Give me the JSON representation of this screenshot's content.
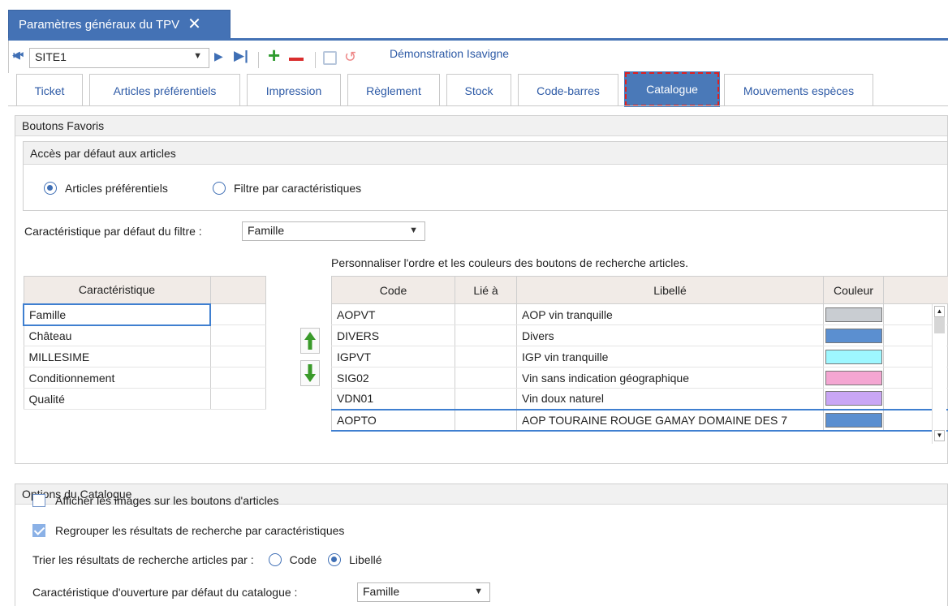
{
  "window": {
    "tab_title": "Paramètres généraux du TPV"
  },
  "toolbar": {
    "site_value": "SITE1",
    "company": "Démonstration Isavigne"
  },
  "tabs": [
    {
      "label": "Ticket"
    },
    {
      "label": "Articles préférentiels"
    },
    {
      "label": "Impression"
    },
    {
      "label": "Règlement"
    },
    {
      "label": "Stock"
    },
    {
      "label": "Code-barres"
    },
    {
      "label": "Catalogue"
    },
    {
      "label": "Mouvements espèces"
    }
  ],
  "favoris": {
    "header": "Boutons Favoris",
    "access": {
      "header": "Accès par défaut aux articles",
      "option1": "Articles préférentiels",
      "option2": "Filtre par caractéristiques",
      "selected": "Articles préférentiels"
    },
    "filter_label": "Caractéristique par défaut du filtre :",
    "filter_value": "Famille",
    "custom_label": "Personnaliser l'ordre et les couleurs des boutons de recherche articles.",
    "char_grid": {
      "header": "Caractéristique",
      "rows": [
        "Famille",
        "Château",
        "MILLESIME",
        "Conditionnement",
        "Qualité"
      ]
    },
    "codes_grid": {
      "headers": {
        "code": "Code",
        "lie": "Lié à",
        "libelle": "Libellé",
        "couleur": "Couleur"
      },
      "rows": [
        {
          "code": "AOPVT",
          "lie": "",
          "libelle": "AOP vin tranquille",
          "color": "#c9cdd2"
        },
        {
          "code": "DIVERS",
          "lie": "",
          "libelle": "Divers",
          "color": "#5b8fd0"
        },
        {
          "code": "IGPVT",
          "lie": "",
          "libelle": "IGP vin tranquille",
          "color": "#9ef7ff"
        },
        {
          "code": "SIG02",
          "lie": "",
          "libelle": "Vin sans indication géographique",
          "color": "#f4a6d2"
        },
        {
          "code": "VDN01",
          "lie": "",
          "libelle": "Vin doux naturel",
          "color": "#c9a6f5"
        },
        {
          "code": "AOPTO",
          "lie": "",
          "libelle": "AOP TOURAINE ROUGE GAMAY DOMAINE DES 7",
          "color": "#5b8fd0"
        }
      ]
    }
  },
  "catalogue": {
    "header": "Options du Catalogue",
    "show_images": "Afficher les images sur les boutons d'articles",
    "show_images_checked": false,
    "group_results": "Regrouper les résultats de recherche par caractéristiques",
    "group_results_checked": true,
    "sort_label": "Trier les résultats de recherche articles par :",
    "sort_code": "Code",
    "sort_libelle": "Libellé",
    "sort_selected": "Libellé",
    "open_label": "Caractéristique d'ouverture par défaut du catalogue :",
    "open_value": "Famille"
  },
  "colors": {
    "accent": "#4472b5",
    "add": "#2e9b2e",
    "remove": "#d92d2d"
  }
}
